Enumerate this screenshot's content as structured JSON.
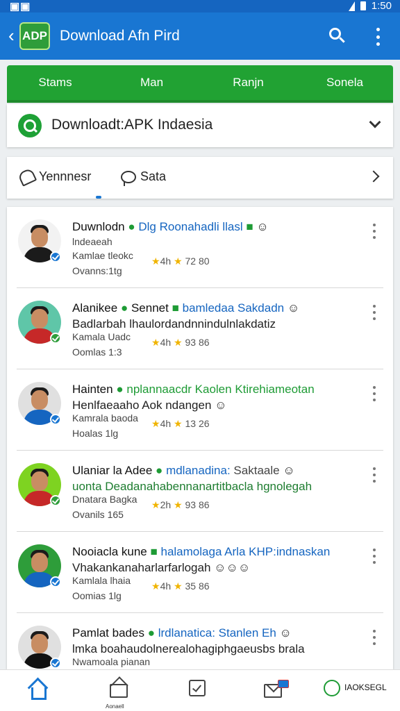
{
  "status_bar": {
    "left": "▣▣",
    "right": "1:50"
  },
  "app_bar": {
    "logo_text": "ADP",
    "title": "Download Afn Pird"
  },
  "tabs": [
    "Stams",
    "Man",
    "Ranjn",
    "Sonela"
  ],
  "source_dropdown": {
    "value": "Downloadt:APK Indaesia"
  },
  "filters": {
    "first": "Yennnesr",
    "second": "Sata"
  },
  "posts": [
    {
      "name": "Duwnlodn",
      "tag": "Dlg Roonahadli llasl",
      "line2": "",
      "sub1": "lndeaeah",
      "sub2": "Kamlae tleokc",
      "sub3": "Ovanns:1tg",
      "time": "4h",
      "likes": "72 80",
      "avatar_bg": "#f2f2f2",
      "shirt": "#1b1b1b",
      "badge": "#1976d2"
    },
    {
      "name": "Alanikee",
      "tag": "Sennet",
      "tag2": "bamledaa Sakdadn",
      "line2": "Badlarbah lhaulordandnnindulnlakdatiz",
      "sub1": "Kamala Uadc",
      "sub2": "Oomlas 1:3",
      "sub3": "",
      "time": "4h",
      "likes": "93 86",
      "avatar_bg": "#5fc6a8",
      "shirt": "#c62828",
      "badge": "#2e9d3a"
    },
    {
      "name": "Hainten",
      "tag": "nplannaacdr Kaolen Ktirehiameotan",
      "line2": "Henlfaeaaho Aok ndangen",
      "sub1": "Kamrala baoda",
      "sub2": "Hoalas 1lg",
      "sub3": "",
      "time": "4h",
      "likes": "13 26",
      "avatar_bg": "#e0e0e0",
      "shirt": "#1565c0",
      "badge": "#1976d2"
    },
    {
      "name": "Ulaniar la Adee",
      "tag": "mdlanadina:",
      "tag2": "Saktaale",
      "line2": "uonta Deadanahabennanartitbacla hgnolegah",
      "sub1": "Dnatara Bagka",
      "sub2": "Ovanils 165",
      "sub3": "",
      "time": "2h",
      "likes": "93 86",
      "avatar_bg": "#7ed321",
      "shirt": "#c62828",
      "badge": "#2e9d3a"
    },
    {
      "name": "Nooiacla kune",
      "tag": "halamolaga Arla KHP:indnaskan",
      "line2": "Vhakankanaharlarfarlogah",
      "sub1": "Kamlala lhaia",
      "sub2": "Oomias 1lg",
      "sub3": "",
      "time": "4h",
      "likes": "35 86",
      "avatar_bg": "#2e9d3a",
      "shirt": "#1565c0",
      "badge": "#1976d2"
    },
    {
      "name": "Pamlat bades",
      "tag": "lrdlanatica: Stanlen Eh",
      "line2": "lmka boahaudolnerealohagiphgaeusbs brala",
      "sub1": "Nwamoala pianan",
      "sub2": "",
      "sub3": "",
      "time": "",
      "likes": "",
      "avatar_bg": "#e0e0e0",
      "shirt": "#111",
      "badge": "#1976d2"
    }
  ],
  "bottom_nav": {
    "store_label": "Aonaell",
    "apk_label": "IAOKSEGL"
  },
  "colors": {
    "primary": "#1976d2",
    "accent_green": "#21a233",
    "star": "#f0b400"
  },
  "icons": [
    "back-icon",
    "search-icon",
    "more-icon",
    "search-circle-icon",
    "chevron-down-icon",
    "bell-icon",
    "bubble-icon",
    "chevron-right-icon",
    "verified-icon",
    "home-icon",
    "store-icon",
    "task-icon",
    "mail-icon",
    "apk-icon"
  ]
}
